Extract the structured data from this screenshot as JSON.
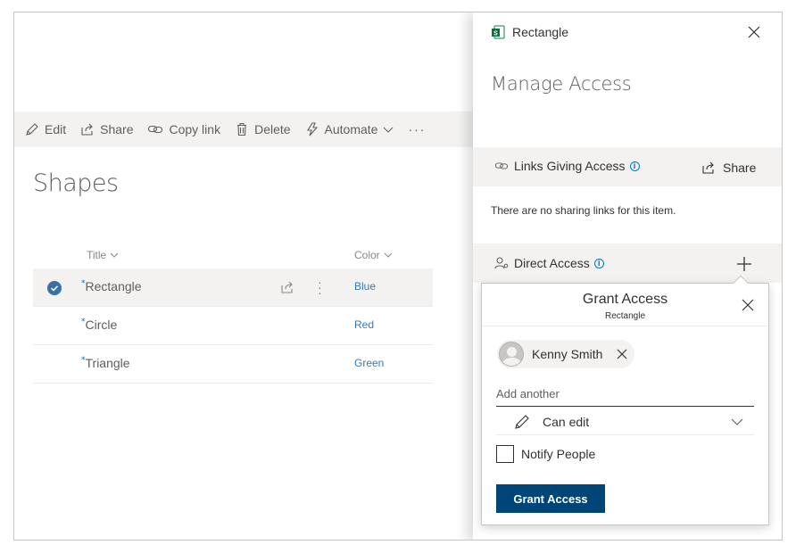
{
  "command_bar": {
    "edit": "Edit",
    "share": "Share",
    "copy_link": "Copy link",
    "delete": "Delete",
    "automate": "Automate",
    "more": "···"
  },
  "page": {
    "title": "Shapes"
  },
  "list": {
    "headers": {
      "title": "Title",
      "color": "Color"
    },
    "rows": [
      {
        "title": "Rectangle",
        "color": "Blue",
        "selected": true
      },
      {
        "title": "Circle",
        "color": "Red",
        "selected": false
      },
      {
        "title": "Triangle",
        "color": "Green",
        "selected": false
      }
    ]
  },
  "panel": {
    "file_name": "Rectangle",
    "title": "Manage Access",
    "links_section": {
      "label": "Links Giving Access",
      "share": "Share"
    },
    "no_links_text": "There are no sharing links for this item.",
    "direct_access": {
      "label": "Direct Access"
    }
  },
  "grant": {
    "title": "Grant Access",
    "subtitle": "Rectangle",
    "person": "Kenny Smith",
    "add_placeholder": "Add another",
    "permission": "Can edit",
    "notify_label": "Notify People",
    "button": "Grant Access"
  },
  "colors": {
    "accent": "#0078d4",
    "button": "#004578",
    "link": "#3a78b5"
  },
  "icons": [
    "edit-icon",
    "share-icon",
    "link-icon",
    "delete-icon",
    "automate-icon",
    "chevron-down-icon",
    "checkmark-circle-icon",
    "close-icon",
    "plus-icon",
    "info-icon",
    "person-icon",
    "pencil-icon",
    "sway-file-icon"
  ]
}
